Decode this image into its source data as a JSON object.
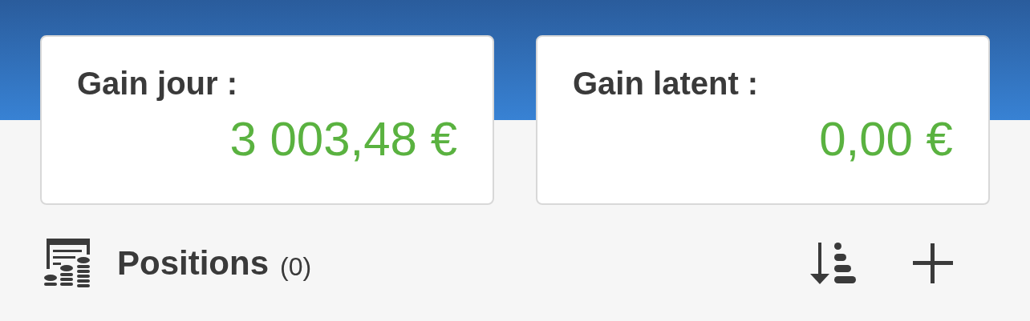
{
  "summary_cards": [
    {
      "title": "Gain jour :",
      "value": "3 003,48 €"
    },
    {
      "title": "Gain latent :",
      "value": "0,00 €"
    }
  ],
  "positions": {
    "title": "Positions",
    "count": "(0)"
  }
}
